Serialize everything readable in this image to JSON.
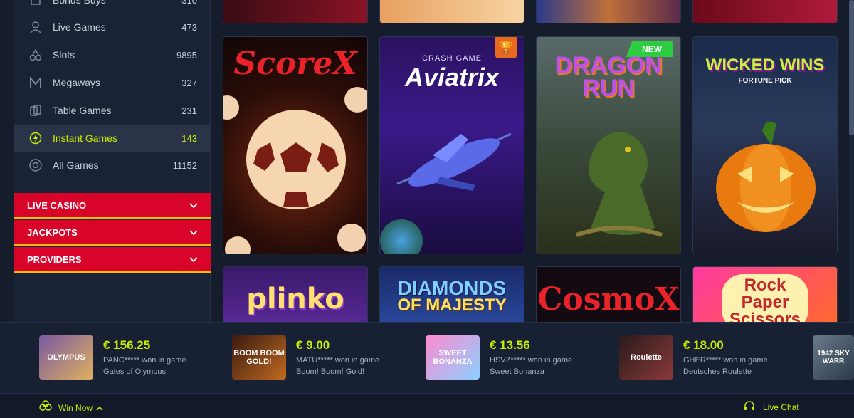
{
  "sidebar": {
    "items": [
      {
        "label": "Bonus Buys",
        "count": "310",
        "icon": "bonus-buy-icon"
      },
      {
        "label": "Live Games",
        "count": "473",
        "icon": "live-dealer-icon"
      },
      {
        "label": "Slots",
        "count": "9895",
        "icon": "cherries-icon"
      },
      {
        "label": "Megaways",
        "count": "327",
        "icon": "megaways-icon"
      },
      {
        "label": "Table Games",
        "count": "231",
        "icon": "cards-icon"
      },
      {
        "label": "Instant Games",
        "count": "143",
        "icon": "instant-games-icon",
        "active": true
      },
      {
        "label": "All Games",
        "count": "11152",
        "icon": "chip-icon"
      }
    ],
    "accordions": [
      {
        "label": "LIVE CASINO"
      },
      {
        "label": "JACKPOTS"
      },
      {
        "label": "PROVIDERS"
      }
    ]
  },
  "games": {
    "row1": [
      {
        "title": "ScoreX"
      },
      {
        "subtitle": "CRASH GAME",
        "title": "Aviatrix"
      },
      {
        "title": "DRAGON RUN",
        "badge": "NEW"
      },
      {
        "title": "WICKED WINS",
        "subtitle": "FORTUNE PICK"
      }
    ],
    "row2": [
      {
        "title": "plinko"
      },
      {
        "title": "DIAMONDS",
        "subtitle": "OF MAJESTY"
      },
      {
        "title": "CosmoX"
      },
      {
        "title": "Rock Paper Scissors"
      }
    ]
  },
  "winners": [
    {
      "amount": "€ 156.25",
      "user": "PANC***** won in game",
      "game": "Gates of Olympus",
      "thumb": "OLYMPUS"
    },
    {
      "amount": "€ 9.00",
      "user": "MATU***** won in game",
      "game": "Boom! Boom! Gold!",
      "thumb": "BOOM BOOM GOLD!"
    },
    {
      "amount": "€ 13.56",
      "user": "HSVZ***** won in game",
      "game": "Sweet Bonanza",
      "thumb": "SWEET BONANZA"
    },
    {
      "amount": "€ 18.00",
      "user": "GHER***** won in game",
      "game": "Deutsches Roulette",
      "thumb": "Roulette"
    },
    {
      "thumb": "1942 SKY WARR"
    }
  ],
  "footer": {
    "win_now": "Win Now",
    "live_chat": "Live Chat"
  },
  "colors": {
    "accent": "#c8f000",
    "danger": "#d90429",
    "bg": "#151d2d"
  }
}
